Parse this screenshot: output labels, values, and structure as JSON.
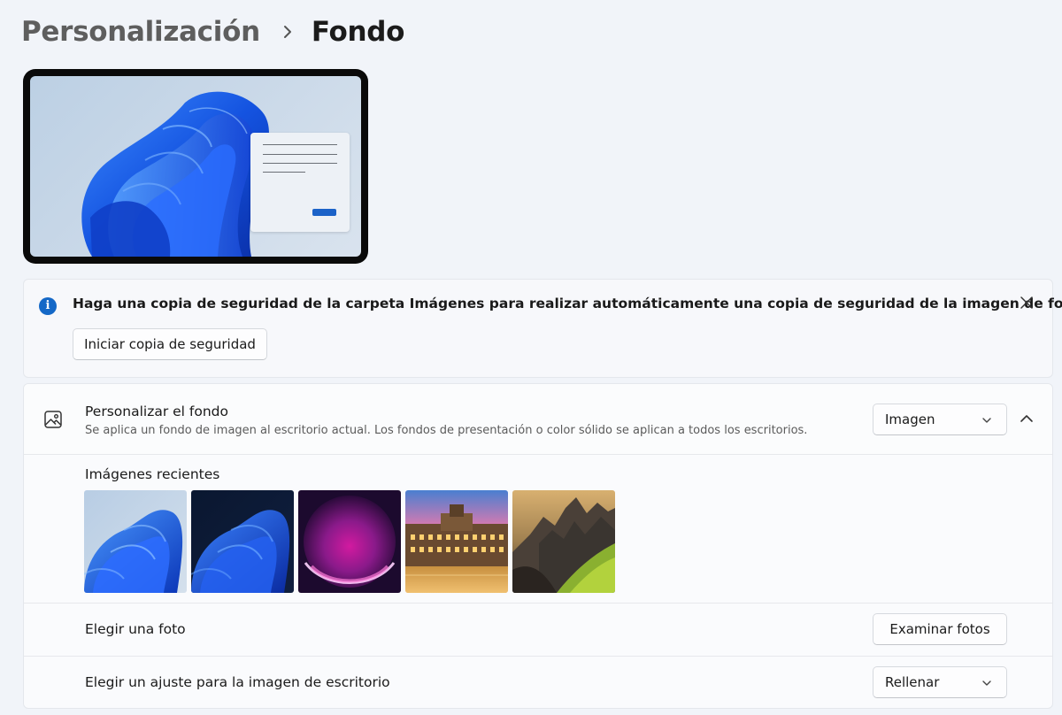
{
  "breadcrumb": {
    "parent": "Personalización",
    "current": "Fondo"
  },
  "info_banner": {
    "message": "Haga una copia de seguridad de la carpeta Imágenes para realizar automáticamente una copia de seguridad de la imagen de fondo.",
    "action_label": "Iniciar copia de seguridad",
    "icon": "info-icon",
    "accent_color": "#1468c7"
  },
  "personalize": {
    "title": "Personalizar el fondo",
    "description": "Se aplica un fondo de imagen al escritorio actual. Los fondos de presentación o color sólido se aplican a todos los escritorios.",
    "selected": "Imagen",
    "icon": "picture-icon",
    "expanded": true
  },
  "recent": {
    "label": "Imágenes recientes",
    "images": [
      {
        "name": "windows-bloom-light"
      },
      {
        "name": "windows-bloom-dark"
      },
      {
        "name": "purple-glow"
      },
      {
        "name": "city-hall-sunset"
      },
      {
        "name": "mountain-sunset"
      }
    ]
  },
  "choose_photo": {
    "label": "Elegir una foto",
    "button_label": "Examinar fotos"
  },
  "fit": {
    "label": "Elegir un ajuste para la imagen de escritorio",
    "selected": "Rellenar"
  }
}
